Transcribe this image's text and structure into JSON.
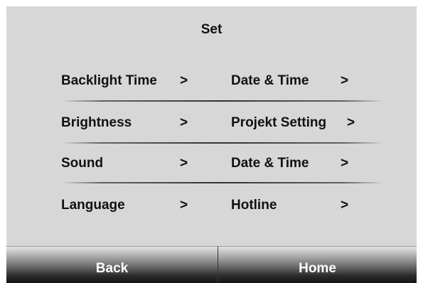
{
  "header": {
    "title": "Set"
  },
  "menu": {
    "left": [
      {
        "label": "Backlight Time",
        "arrow": ">"
      },
      {
        "label": "Brightness",
        "arrow": ">"
      },
      {
        "label": "Sound",
        "arrow": ">"
      },
      {
        "label": "Language",
        "arrow": ">"
      }
    ],
    "right": [
      {
        "label": "Date & Time",
        "arrow": ">"
      },
      {
        "label": "Projekt Setting",
        "arrow": ">"
      },
      {
        "label": "Date & Time",
        "arrow": ">"
      },
      {
        "label": "Hotline",
        "arrow": ">"
      }
    ]
  },
  "footer": {
    "back_label": "Back",
    "home_label": "Home"
  },
  "colors": {
    "background": "#d7d7d7",
    "text": "#111111",
    "button_text": "#ffffff"
  }
}
